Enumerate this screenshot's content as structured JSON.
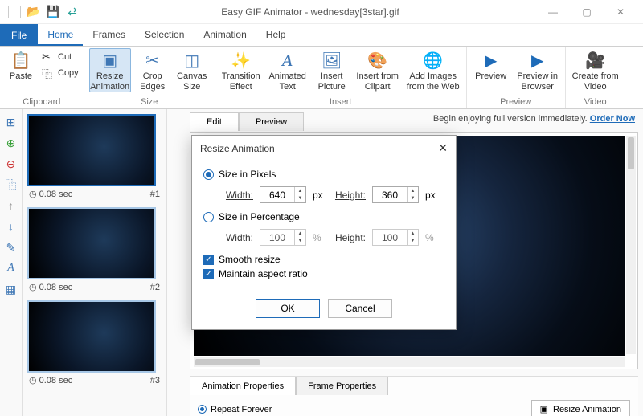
{
  "app_title": "Easy GIF Animator - wednesday[3star].gif",
  "menu": {
    "file": "File",
    "tabs": [
      "Home",
      "Frames",
      "Selection",
      "Animation",
      "Help"
    ],
    "active": 0
  },
  "ribbon": {
    "clipboard": {
      "label": "Clipboard",
      "paste": "Paste",
      "cut": "Cut",
      "copy": "Copy"
    },
    "size": {
      "label": "Size",
      "resize": "Resize Animation",
      "crop": "Crop Edges",
      "canvas": "Canvas Size"
    },
    "insert": {
      "label": "Insert",
      "transition": "Transition Effect",
      "animtext": "Animated Text",
      "picture": "Insert Picture",
      "clipart": "Insert from Clipart",
      "web": "Add Images from the Web"
    },
    "preview": {
      "label": "Preview",
      "preview": "Preview",
      "browser": "Preview in Browser"
    },
    "video": {
      "label": "Video",
      "create": "Create from Video"
    }
  },
  "frames": [
    {
      "duration": "0.08 sec",
      "index": "#1"
    },
    {
      "duration": "0.08 sec",
      "index": "#2"
    },
    {
      "duration": "0.08 sec",
      "index": "#3"
    }
  ],
  "view_tabs": {
    "edit": "Edit",
    "preview": "Preview"
  },
  "trial": {
    "msg": "Begin enjoying full version immediately.",
    "link": "Order Now"
  },
  "prop_tabs": {
    "anim": "Animation Properties",
    "frame": "Frame Properties",
    "repeat": "Repeat Forever",
    "resize_btn": "Resize Animation"
  },
  "dialog": {
    "title": "Resize Animation",
    "size_px": "Size in Pixels",
    "size_pct": "Size in Percentage",
    "width": "Width:",
    "height": "Height:",
    "px_w": "640",
    "px_h": "360",
    "pct_w": "100",
    "pct_h": "100",
    "px": "px",
    "pct": "%",
    "smooth": "Smooth resize",
    "aspect": "Maintain aspect ratio",
    "ok": "OK",
    "cancel": "Cancel"
  }
}
